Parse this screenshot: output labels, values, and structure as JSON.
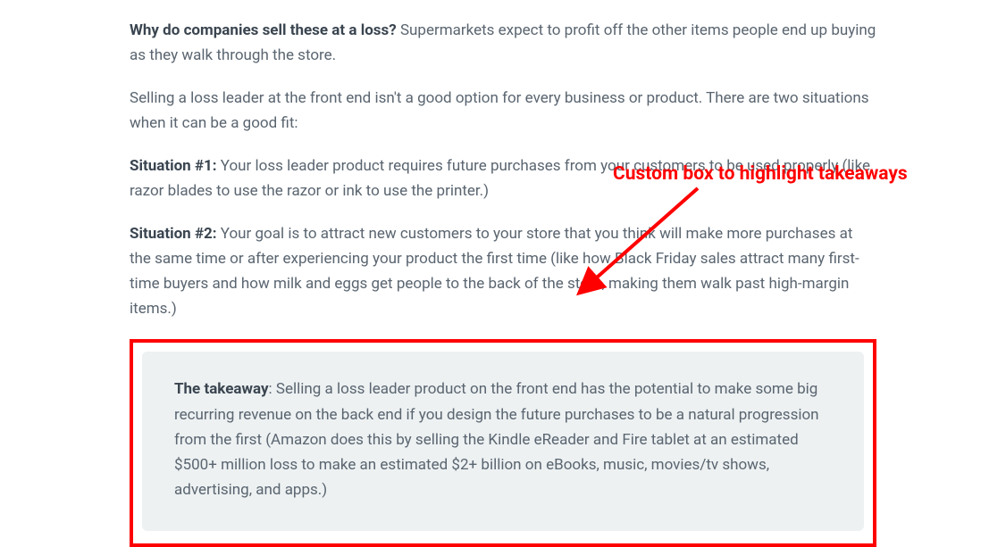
{
  "paragraphs": {
    "p1_lead": "Why do companies sell these at a loss?",
    "p1_body": " Supermarkets expect to profit off the other items people end up buying as they walk through the store.",
    "p2": "Selling a loss leader at the front end isn't a good option for every business or product. There are two situations when it can be a good fit:",
    "p3_lead": "Situation #1:",
    "p3_body": " Your loss leader product requires future purchases from your customers to be used properly (like razor blades to use the razor or ink to use the printer.)",
    "p4_lead": "Situation #2:",
    "p4_body": " Your goal is to attract new customers to your store that you think will make more purchases at the same time or after experiencing your product the first time (like how Black Friday sales attract many first-time buyers and how milk and eggs get people to the back of the store, making them walk past high-margin items.)"
  },
  "takeaway": {
    "label": "The takeaway",
    "body": ": Selling a loss leader product on the front end has the potential to make some big recurring revenue on the back end if you design the future purchases to be a natural progression from the first (Amazon does this by selling the Kindle eReader and Fire tablet at an estimated $500+ million loss to make an estimated $2+ billion on eBooks, music, movies/tv shows, advertising, and apps.)"
  },
  "annotation": {
    "text": "Custom box to highlight takeaways"
  }
}
